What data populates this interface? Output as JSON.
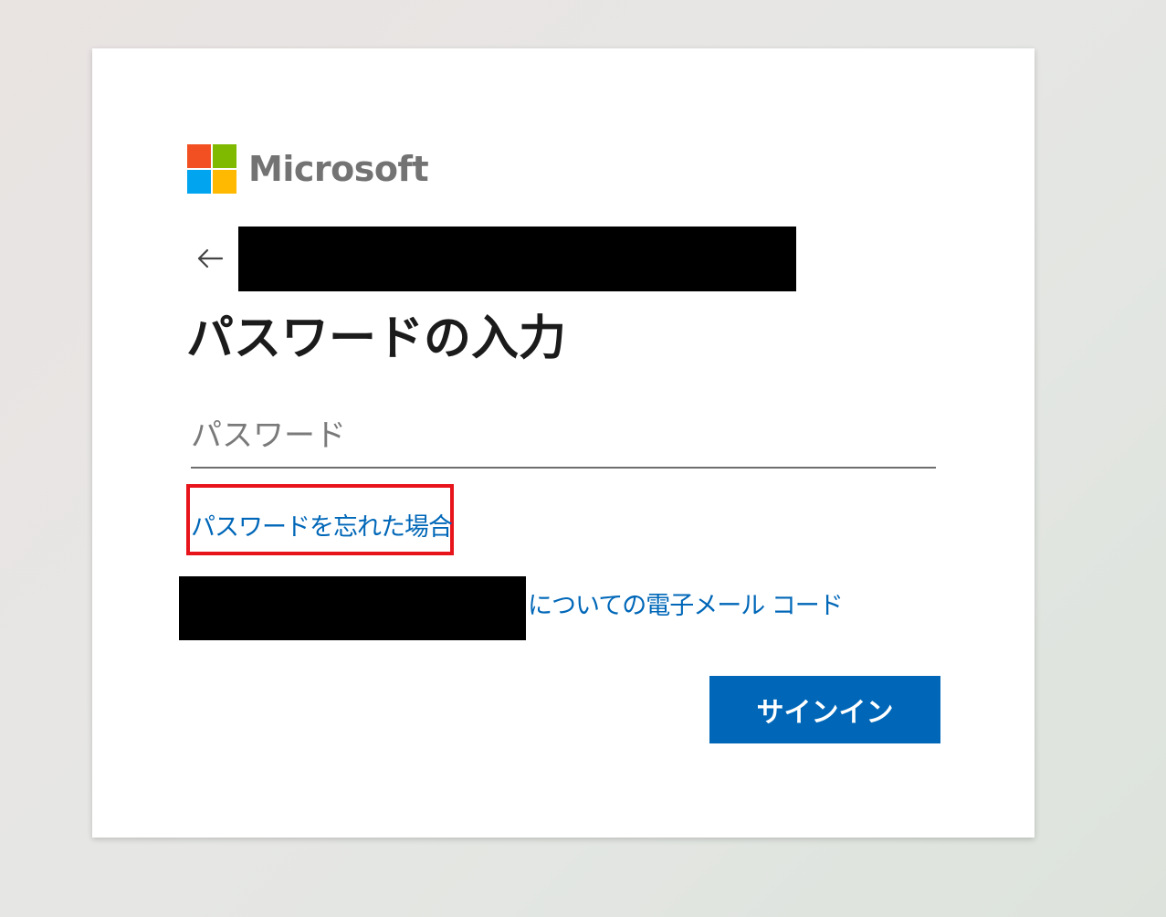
{
  "brand": {
    "name": "Microsoft",
    "logo_colors": [
      "#f25022",
      "#7fba00",
      "#00a4ef",
      "#ffb900"
    ]
  },
  "account": {
    "back_icon": "back-arrow-icon",
    "identifier": ""
  },
  "title": "パスワードの入力",
  "password": {
    "placeholder": "パスワード",
    "value": ""
  },
  "links": {
    "forgot_password": "パスワードを忘れた場合",
    "email_code_suffix": "についての電子メール コード"
  },
  "actions": {
    "signin_label": "サインイン"
  },
  "colors": {
    "accent": "#0067b8",
    "highlight_border": "#e8141c"
  }
}
